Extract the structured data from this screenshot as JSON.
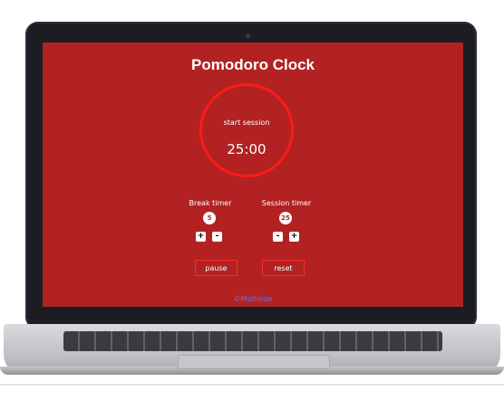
{
  "app": {
    "title": "Pomodoro Clock",
    "clock": {
      "label": "start session",
      "time": "25:00"
    },
    "break_timer": {
      "label": "Break timer",
      "value": "5",
      "plus": "+",
      "minus": "-"
    },
    "session_timer": {
      "label": "Session timer",
      "value": "25",
      "minus": "-",
      "plus": "+"
    },
    "controls": {
      "pause": "pause",
      "reset": "reset"
    },
    "footer": "©Mathilde"
  },
  "colors": {
    "background": "#b22222",
    "accent": "#ff1a1a",
    "footer_link": "#6d71d8"
  }
}
